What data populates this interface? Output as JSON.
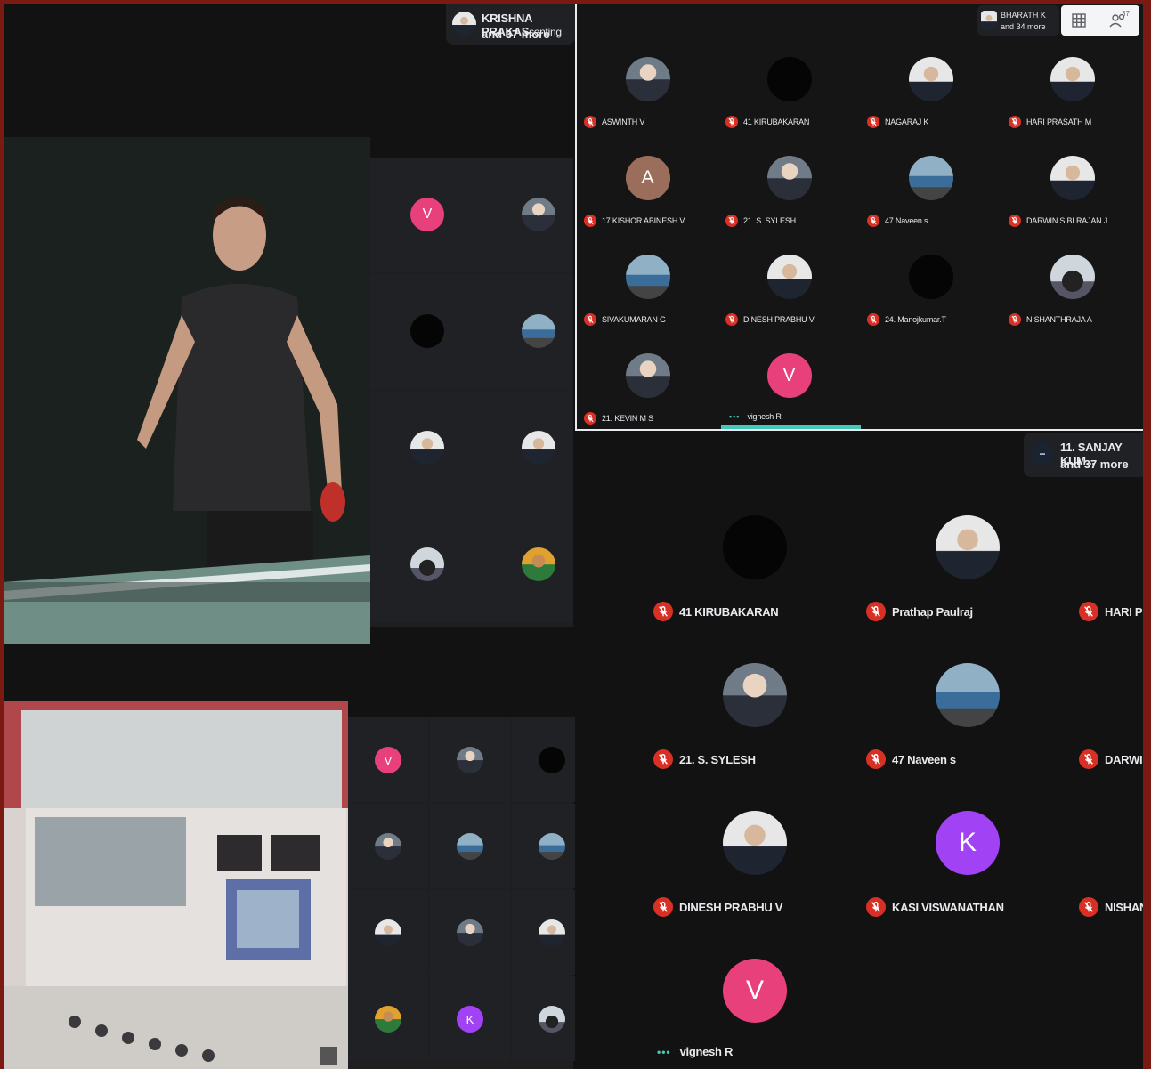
{
  "colors": {
    "accent_red": "#d93025",
    "teal": "#44c8b8",
    "pink": "#e8407a",
    "purple": "#a142f4",
    "brown": "#9a6e5a"
  },
  "top_presenter": {
    "name": "KRISHNA PRAKAS",
    "suffix": "senting",
    "more": "and 37 more"
  },
  "top_right": {
    "name": "BHARATH K",
    "more": "and 34 more",
    "grid_icon": "grid-icon",
    "people_icon": "people-icon",
    "people_count": "37"
  },
  "grid_top": [
    {
      "name": "ASWINTH V",
      "avatar": "photo"
    },
    {
      "name": "41 KIRUBAKARAN",
      "avatar": "dark"
    },
    {
      "name": "NAGARAJ K",
      "avatar": "suit"
    },
    {
      "name": "HARI PRASATH M",
      "avatar": "suit"
    },
    {
      "name": "17 KISHOR ABINESH V",
      "letter": "A",
      "color": "#9a6e5a"
    },
    {
      "name": "21. S. SYLESH",
      "avatar": "photo"
    },
    {
      "name": "47 Naveen s",
      "avatar": "car"
    },
    {
      "name": "DARWIN SIBI RAJAN J",
      "avatar": "suit"
    },
    {
      "name": "SIVAKUMARAN G",
      "avatar": "car"
    },
    {
      "name": "DINESH PRABHU V",
      "avatar": "suit"
    },
    {
      "name": "24. Manojkumar.T",
      "avatar": "dark"
    },
    {
      "name": "NISHANTHRAJA A",
      "avatar": "bike"
    },
    {
      "name": "21. KEVIN M S",
      "avatar": "photo"
    },
    {
      "name": "vignesh R",
      "letter": "V",
      "color": "#e8407a",
      "speaking": true
    }
  ],
  "bottom_presenter": {
    "name": "11. SANJAY KUM...",
    "more": "and 37 more"
  },
  "grid_bottom": [
    {
      "name": "41 KIRUBAKARAN",
      "avatar": "dark"
    },
    {
      "name": "Prathap Paulraj",
      "avatar": "suit"
    },
    {
      "name": "HARI PR",
      "avatar": "none"
    },
    {
      "name": "21. S. SYLESH",
      "avatar": "photo"
    },
    {
      "name": "47 Naveen s",
      "avatar": "car"
    },
    {
      "name": "DARWIN",
      "avatar": "none"
    },
    {
      "name": "DINESH PRABHU V",
      "avatar": "suit"
    },
    {
      "name": "KASI VISWANATHAN",
      "letter": "K",
      "color": "#a142f4"
    },
    {
      "name": "NISHAN",
      "avatar": "none"
    },
    {
      "name": "vignesh R",
      "letter": "V",
      "color": "#e8407a",
      "speaking": true
    }
  ],
  "left_strip_top": [
    {
      "letter": "V",
      "color": "#e8407a"
    },
    {
      "avatar": "photo"
    },
    {
      "avatar": "dark"
    },
    {
      "avatar": "car"
    },
    {
      "avatar": "suit"
    },
    {
      "avatar": "suit"
    },
    {
      "avatar": "bike"
    },
    {
      "avatar": "yellow"
    }
  ],
  "left_strip_bottom": [
    {
      "letter": "V",
      "color": "#e8407a"
    },
    {
      "avatar": "photo"
    },
    {
      "avatar": "dark"
    },
    {
      "avatar": "photo"
    },
    {
      "avatar": "car"
    },
    {
      "avatar": "car"
    },
    {
      "avatar": "suit"
    },
    {
      "avatar": "photo"
    },
    {
      "avatar": "suit"
    },
    {
      "avatar": "yellow"
    },
    {
      "letter": "K",
      "color": "#a142f4"
    },
    {
      "avatar": "bike"
    }
  ],
  "videos": {
    "top": "table-tennis-video",
    "bottom": "control-panel-video"
  }
}
